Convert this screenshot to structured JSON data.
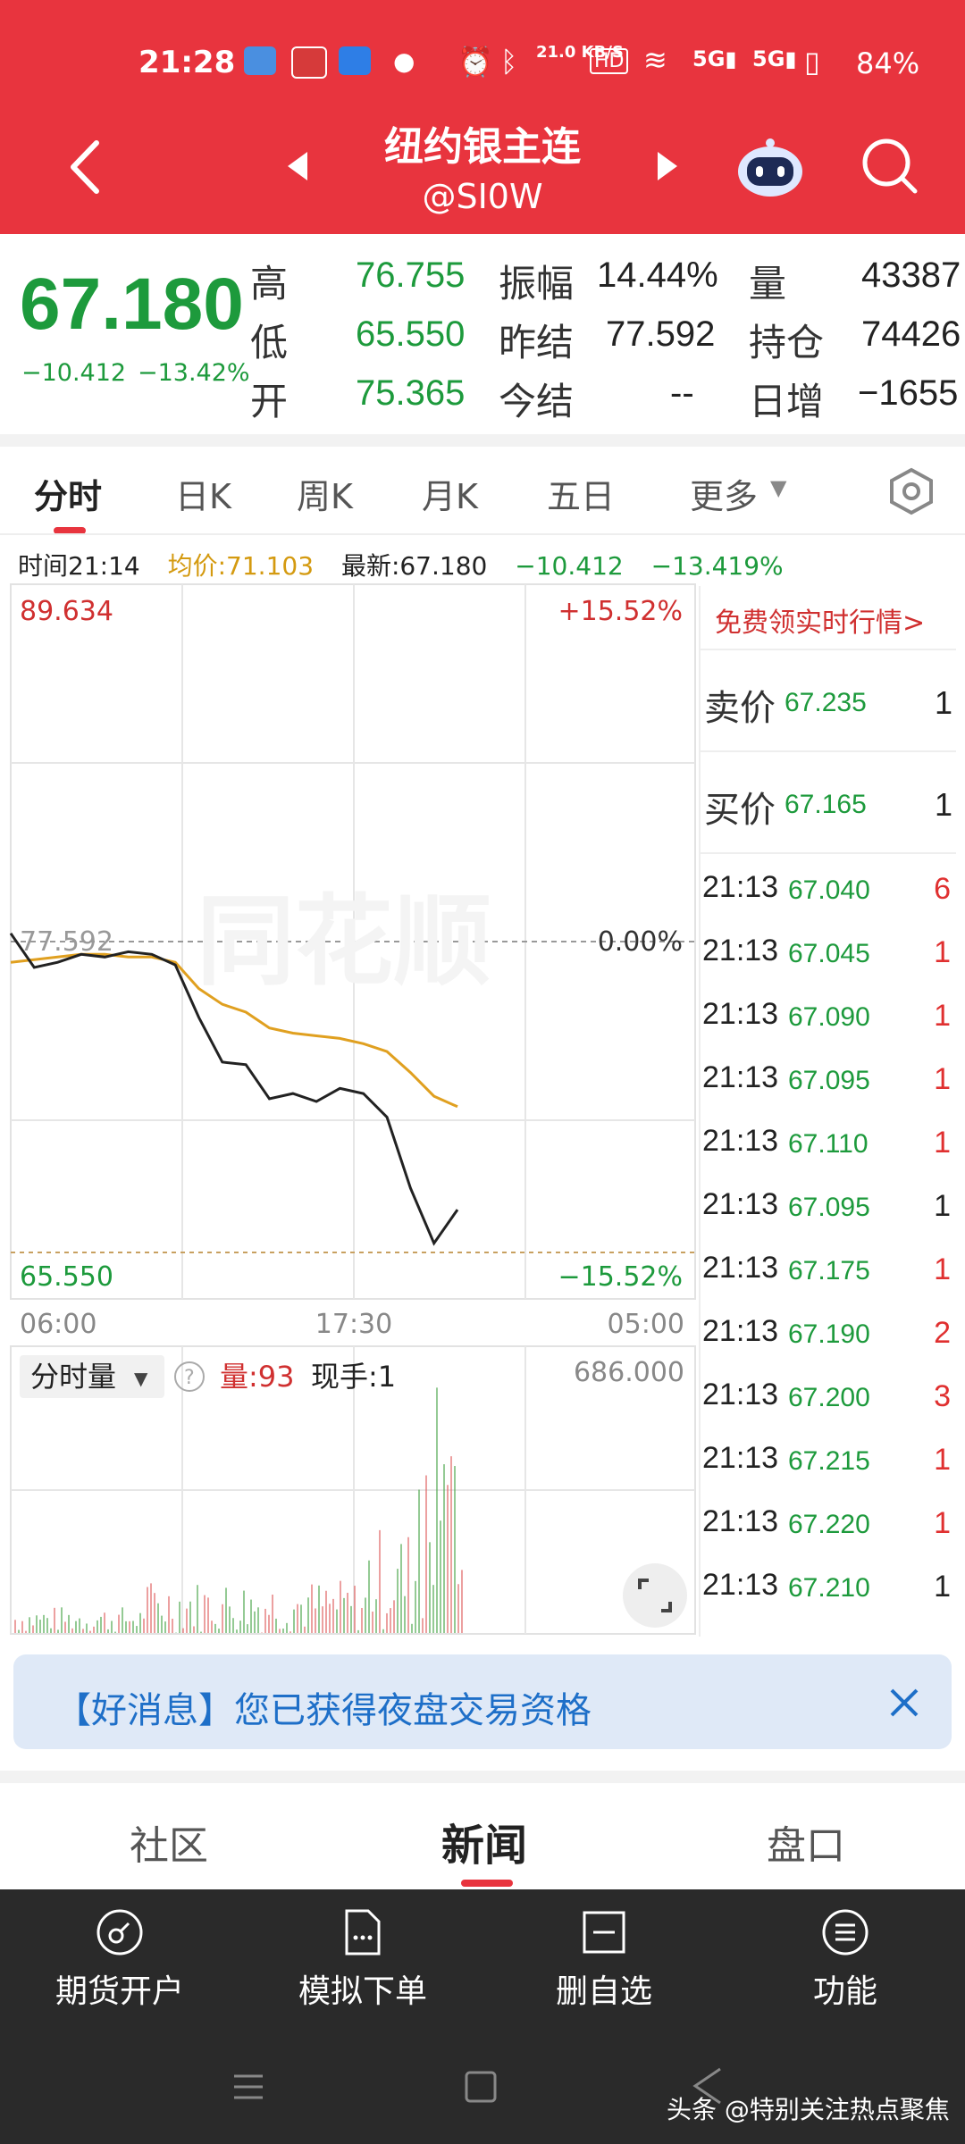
{
  "status_bar": {
    "time": "21:28",
    "net_speed": "21.0 KB/S",
    "battery": "84%"
  },
  "header": {
    "title": "纽约银主连",
    "subtitle": "@SI0W"
  },
  "quote": {
    "price": "67.180",
    "change": "−10.412",
    "change_pct": "−13.42%",
    "labels": {
      "high": "高",
      "low": "低",
      "open": "开",
      "amplitude": "振幅",
      "prev_settle": "昨结",
      "today_settle": "今结",
      "volume": "量",
      "open_interest": "持仓",
      "daily_add": "日增"
    },
    "values": {
      "high": "76.755",
      "low": "65.550",
      "open": "75.365",
      "amplitude": "14.44%",
      "prev_settle": "77.592",
      "today_settle": "--",
      "volume": "43387",
      "open_interest": "74426",
      "daily_add": "−1655"
    }
  },
  "tabs": [
    "分时",
    "日K",
    "周K",
    "月K",
    "五日",
    "更多"
  ],
  "info_line": {
    "time": "时间21:14",
    "avg": "均价:71.103",
    "latest": "最新:67.180",
    "chg": "−10.412",
    "pct": "−13.419%"
  },
  "chart": {
    "ymax_label": "89.634",
    "ymax_pct": "+15.52%",
    "ref_label": "77.592",
    "ref_pct": "0.00%",
    "ymin_label": "65.550",
    "ymin_pct": "−15.52%",
    "x_ticks": [
      "06:00",
      "17:30",
      "05:00"
    ],
    "volume_selector": "分时量",
    "volume_label": "量:93",
    "hand_label": "现手:1",
    "volume_max": "686.000",
    "watermark": "同花顺",
    "colors": {
      "price_line": "#222222",
      "avg_line": "#e0a020",
      "vol_up": "#e06060",
      "vol_down": "#4ca64c"
    }
  },
  "chart_data": {
    "type": "line",
    "x_range": [
      "06:00",
      "05:00"
    ],
    "ylim": [
      65.55,
      89.634
    ],
    "reference": 77.592,
    "series": [
      {
        "values": [
          77.7,
          76.4,
          76.6,
          76.9,
          76.8,
          77.0,
          76.9,
          76.5,
          74.5,
          72.8,
          72.7,
          71.4,
          71.6,
          71.3,
          71.8,
          71.6,
          70.7,
          68.0,
          65.9,
          67.18
        ]
      },
      {
        "values": [
          76.6,
          76.7,
          76.8,
          76.9,
          76.9,
          76.8,
          76.8,
          76.6,
          75.6,
          75.0,
          74.7,
          74.1,
          73.9,
          73.8,
          73.7,
          73.5,
          73.2,
          72.4,
          71.5,
          71.103
        ]
      }
    ]
  },
  "order_book": {
    "promo": "免费领实时行情>",
    "sell": {
      "label": "卖价",
      "price": "67.235",
      "qty": "1"
    },
    "buy": {
      "label": "买价",
      "price": "67.165",
      "qty": "1"
    },
    "trades": [
      {
        "t": "21:13",
        "p": "67.040",
        "q": "6"
      },
      {
        "t": "21:13",
        "p": "67.045",
        "q": "1"
      },
      {
        "t": "21:13",
        "p": "67.090",
        "q": "1"
      },
      {
        "t": "21:13",
        "p": "67.095",
        "q": "1"
      },
      {
        "t": "21:13",
        "p": "67.110",
        "q": "1"
      },
      {
        "t": "21:13",
        "p": "67.095",
        "q": "1"
      },
      {
        "t": "21:13",
        "p": "67.175",
        "q": "1"
      },
      {
        "t": "21:13",
        "p": "67.190",
        "q": "2"
      },
      {
        "t": "21:13",
        "p": "67.200",
        "q": "3"
      },
      {
        "t": "21:13",
        "p": "67.215",
        "q": "1"
      },
      {
        "t": "21:13",
        "p": "67.220",
        "q": "1"
      },
      {
        "t": "21:13",
        "p": "67.210",
        "q": "1"
      }
    ]
  },
  "banner": {
    "text": "【好消息】您已获得夜盘交易资格"
  },
  "bottom_tabs": [
    "社区",
    "新闻",
    "盘口"
  ],
  "footer": {
    "items": [
      "期货开户",
      "模拟下单",
      "删自选",
      "功能"
    ],
    "watermark": "头条 @特别关注热点聚焦"
  }
}
